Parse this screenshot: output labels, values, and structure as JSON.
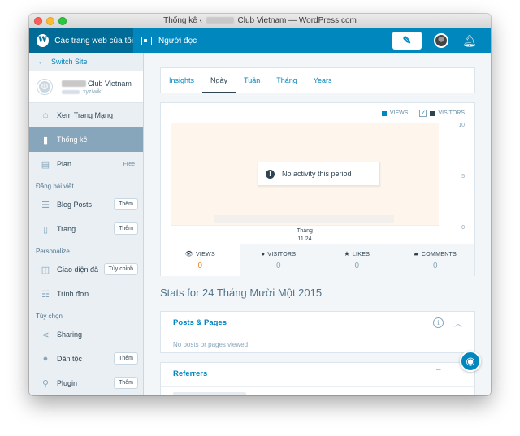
{
  "window": {
    "title_prefix": "Thống kê ‹",
    "title_suffix": "Club Vietnam — WordPress.com"
  },
  "masterbar": {
    "sites_label": "Các trang web của tôi",
    "reader_label": "Người đọc",
    "write_icon": "write-icon",
    "notifications_icon": "bell-icon"
  },
  "sidebar": {
    "switch_site": "Switch Site",
    "site_name": "Club Vietnam",
    "site_url": ".xyz/wiki",
    "items_top": [
      {
        "label": "Xem Trang Mạng",
        "icon": "house-icon"
      },
      {
        "label": "Thống kê",
        "icon": "stats-icon"
      },
      {
        "label": "Plan",
        "icon": "clipboard-icon",
        "badge": "Free"
      }
    ],
    "section_publish": "Đăng bài viết",
    "items_publish": [
      {
        "label": "Blog Posts",
        "button": "Thêm"
      },
      {
        "label": "Trang",
        "button": "Thêm"
      }
    ],
    "section_personalize": "Personalize",
    "items_personalize": [
      {
        "label": "Giao diện đã",
        "button": "Tùy chỉnh"
      },
      {
        "label": "Trình đơn"
      }
    ],
    "section_configure": "Tùy chọn",
    "items_configure": [
      {
        "label": "Sharing"
      },
      {
        "label": "Dân tộc",
        "button": "Thêm"
      },
      {
        "label": "Plugin",
        "button": "Thêm"
      }
    ]
  },
  "tabs": [
    "Insights",
    "Ngày",
    "Tuần",
    "Tháng",
    "Years"
  ],
  "chart": {
    "legend_views": "VIEWS",
    "legend_visitors": "VISITORS",
    "no_activity": "No activity this period",
    "x_label_line1": "Tháng",
    "x_label_line2": "11 24"
  },
  "chart_data": {
    "type": "bar",
    "categories": [
      "Tháng 11 24"
    ],
    "series": [
      {
        "name": "VIEWS",
        "values": [
          0
        ]
      },
      {
        "name": "VISITORS",
        "values": [
          0
        ]
      }
    ],
    "ylim": [
      0,
      10
    ],
    "yticks": [
      "10",
      "5",
      "0"
    ],
    "colors": {
      "views": "#0087be",
      "visitors": "#2e4453",
      "highlight": "#fef5ec"
    }
  },
  "stats": [
    {
      "label": "VIEWS",
      "value": "0",
      "icon": "eye-icon"
    },
    {
      "label": "VISITORS",
      "value": "0",
      "icon": "person-icon"
    },
    {
      "label": "LIKES",
      "value": "0",
      "icon": "star-icon"
    },
    {
      "label": "COMMENTS",
      "value": "0",
      "icon": "comment-icon"
    }
  ],
  "section_title": "Stats for 24 Tháng Mười Một 2015",
  "posts_card": {
    "title": "Posts & Pages",
    "empty": "No posts or pages viewed"
  },
  "referrers_card": {
    "title": "Referrers",
    "dash": "–"
  }
}
